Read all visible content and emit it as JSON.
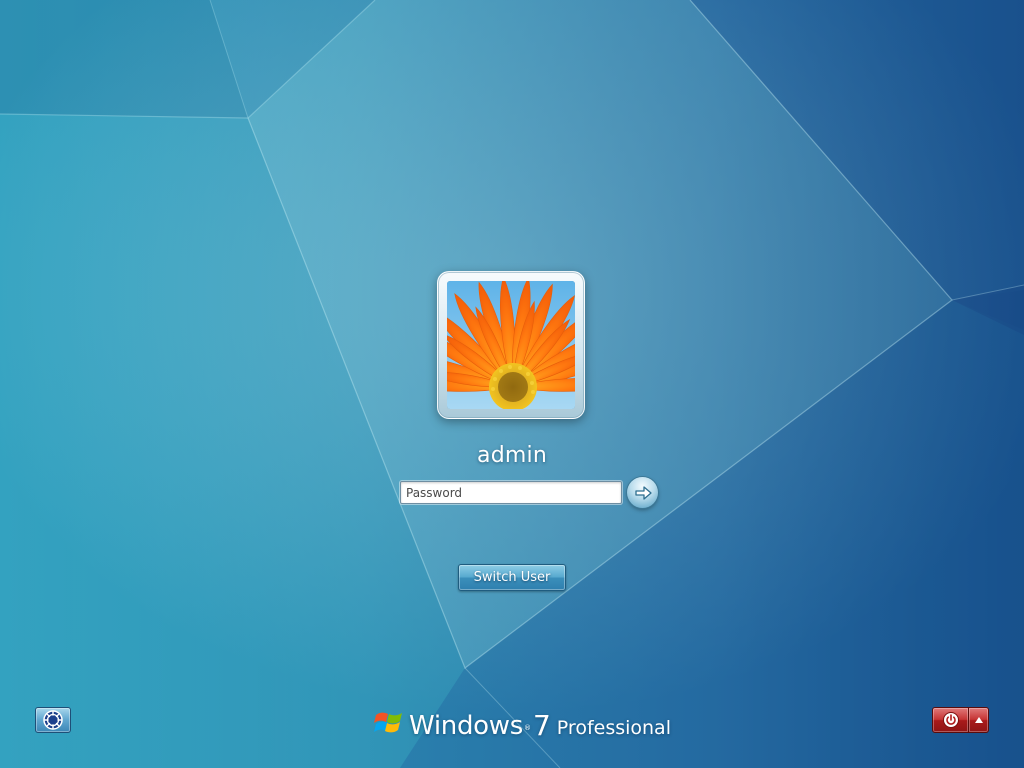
{
  "login": {
    "username": "admin",
    "password_placeholder": "Password",
    "password_value": "",
    "user_picture": "orange-gerbera-daisy"
  },
  "buttons": {
    "switch_user_label": "Switch User",
    "submit_icon": "arrow-right-icon",
    "ease_of_access_icon": "ease-of-access-icon",
    "shutdown_icon": "power-icon",
    "shutdown_options_icon": "triangle-up-icon"
  },
  "branding": {
    "windows": "Windows",
    "trademark": "®",
    "version": "7",
    "edition": "Professional"
  },
  "colors": {
    "background_left": "#3aa9c6",
    "background_right": "#1d5a99",
    "shutdown_red": "#c63434",
    "switch_user_blue": "#4a9cc8"
  }
}
